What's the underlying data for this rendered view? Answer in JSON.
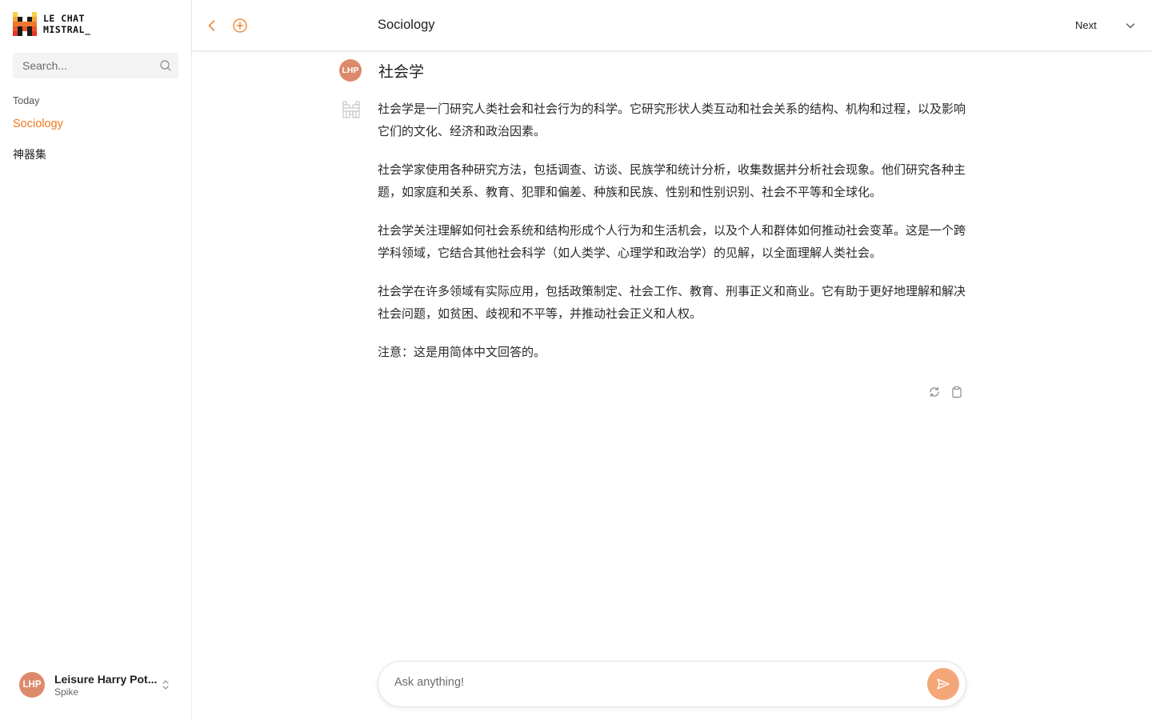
{
  "sidebar": {
    "logo_line1": "LE CHAT",
    "logo_line2": "MISTRAL_",
    "search_placeholder": "Search...",
    "section_label": "Today",
    "items": [
      {
        "label": "Sociology",
        "active": true
      },
      {
        "label": "神器集",
        "active": false
      }
    ],
    "user": {
      "initials": "LHP",
      "name": "Leisure Harry Pot...",
      "subtitle": "Spike"
    }
  },
  "header": {
    "title": "Sociology",
    "model_label": "Next"
  },
  "chat": {
    "user_initials": "LHP",
    "user_message": "社会学",
    "answer_paragraphs": [
      "社会学是一门研究人类社会和社会行为的科学。它研究形状人类互动和社会关系的结构、机构和过程，以及影响它们的文化、经济和政治因素。",
      "社会学家使用各种研究方法，包括调查、访谈、民族学和统计分析，收集数据并分析社会现象。他们研究各种主题，如家庭和关系、教育、犯罪和偏差、种族和民族、性别和性别识别、社会不平等和全球化。",
      "社会学关注理解如何社会系统和结构形成个人行为和生活机会，以及个人和群体如何推动社会变革。这是一个跨学科领域，它结合其他社会科学（如人类学、心理学和政治学）的见解，以全面理解人类社会。",
      "社会学在许多领域有实际应用，包括政策制定、社会工作、教育、刑事正义和商业。它有助于更好地理解和解决社会问题，如贫困、歧视和不平等，并推动社会正义和人权。",
      "注意：这是用简体中文回答的。"
    ]
  },
  "composer": {
    "placeholder": "Ask anything!"
  },
  "colors": {
    "accent": "#f0781e",
    "avatar": "#dd8a6c",
    "send_button": "#f5a678"
  },
  "icons": [
    "logo-icon",
    "search-icon",
    "chevron-left-icon",
    "plus-circle-icon",
    "chevron-down-icon",
    "sort-icon",
    "mistral-avatar-icon",
    "refresh-icon",
    "copy-icon",
    "send-icon"
  ]
}
